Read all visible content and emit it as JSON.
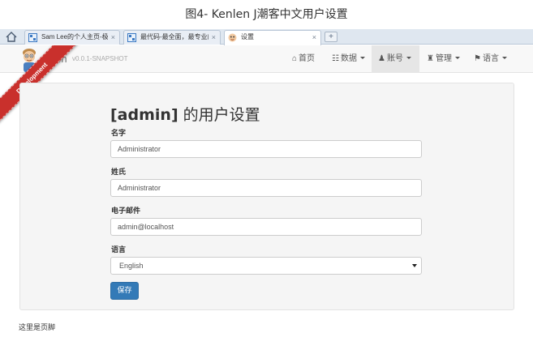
{
  "caption": "图4- Kenlen J潮客中文用户设置",
  "browser": {
    "tabs": [
      {
        "title": "Sam Lee的个人主页-极",
        "close": "×"
      },
      {
        "title": "最代码-最全面，最专业的",
        "close": "×"
      },
      {
        "title": "设置",
        "close": "×"
      }
    ],
    "new_tab": "+"
  },
  "navbar": {
    "brand": "nlen",
    "version": "v0.0.1-SNAPSHOT",
    "items": [
      {
        "label": "首页",
        "icon": "home-icon",
        "glyph": "⌂"
      },
      {
        "label": "数据",
        "icon": "list-icon",
        "glyph": "☷"
      },
      {
        "label": "账号",
        "icon": "user-icon",
        "glyph": "♟"
      },
      {
        "label": "管理",
        "icon": "tower-icon",
        "glyph": "♜"
      },
      {
        "label": "语言",
        "icon": "flag-icon",
        "glyph": "⚑"
      }
    ]
  },
  "ribbon": "Development",
  "form": {
    "title_user": "[admin]",
    "title_rest": " 的用户设置",
    "first_name_label": "名字",
    "first_name_value": "Administrator",
    "last_name_label": "姓氏",
    "last_name_value": "Administrator",
    "email_label": "电子邮件",
    "email_value": "admin@localhost",
    "language_label": "语言",
    "language_value": "English",
    "save_label": "保存"
  },
  "footer": "这里是页脚",
  "colors": {
    "primary": "#337ab7",
    "ribbon": "#c9302c",
    "navbar_bg": "#f8f8f8",
    "well_bg": "#f5f5f5"
  }
}
